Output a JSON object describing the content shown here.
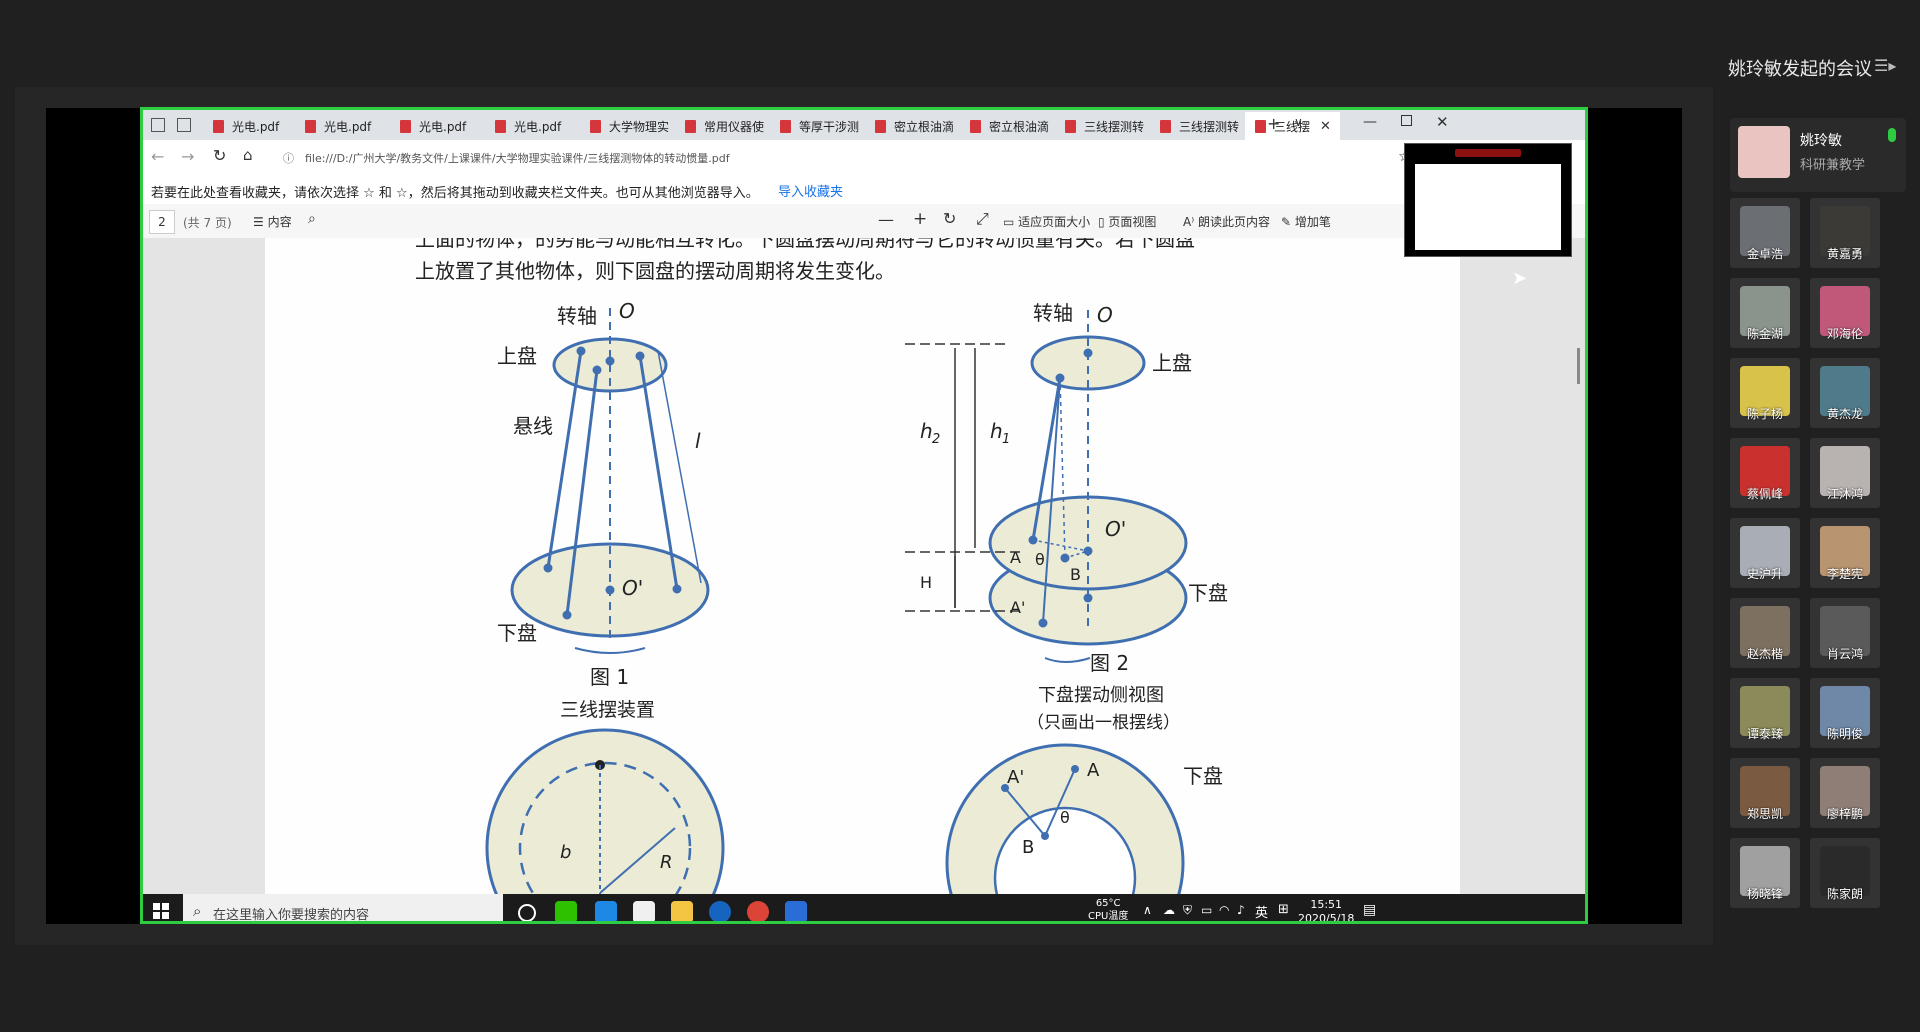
{
  "meeting": {
    "title": "姚玲敏发起的会议",
    "menu_icon": "list-icon"
  },
  "browser": {
    "tabs": [
      {
        "label": "光电.pdf"
      },
      {
        "label": "光电.pdf"
      },
      {
        "label": "光电.pdf"
      },
      {
        "label": "光电.pdf"
      },
      {
        "label": "大学物理实"
      },
      {
        "label": "常用仪器使"
      },
      {
        "label": "等厚干涉测"
      },
      {
        "label": "密立根油滴"
      },
      {
        "label": "密立根油滴"
      },
      {
        "label": "三线摆测转"
      },
      {
        "label": "三线摆测转"
      },
      {
        "label": "三线摆"
      }
    ],
    "address": "file:///D:/广州大学/教务文件/上课课件/大学物理实验课件/三线摆测物体的转动惯量.pdf",
    "favbar_text": "若要在此处查看收藏夹，请依次选择 ☆ 和 ☆，然后将其拖动到收藏夹栏文件夹。也可从其他浏览器导入。",
    "favbar_link": "导入收藏夹"
  },
  "pdf_toolbar": {
    "page_number": "2",
    "page_total": "(共 7 页)",
    "contents_label": "内容",
    "fit_label": "适应页面大小",
    "page_view_label": "页面视图",
    "read_aloud_label": "朗读此页内容",
    "add_note_label": "增加笔"
  },
  "document": {
    "top_line": "上面的物体，的势能与动能相互转化。下圆盘摆动周期将与它的转动惯量有关。若下圆盘",
    "line2": "上放置了其他物体，则下圆盘的摆动周期将发生变化。",
    "fig1": {
      "axis_label": "转轴",
      "o_label": "O",
      "top_disk": "上盘",
      "wire": "悬线",
      "l_label": "l",
      "o_prime": "O'",
      "bottom_disk": "下盘",
      "caption": "图 1",
      "subtitle": "三线摆装置"
    },
    "fig2": {
      "axis_label": "转轴",
      "o_label": "O",
      "top_disk": "上盘",
      "h2": "h",
      "h2_sub": "2",
      "h1": "h",
      "h1_sub": "1",
      "o_prime": "O'",
      "a_label": "A",
      "theta": "θ",
      "b_label": "B",
      "a_prime": "A'",
      "H_label": "H",
      "bottom_disk": "下盘",
      "caption": "图 2",
      "subtitle": "下盘摆动侧视图",
      "note": "（只画出一根摆线）"
    },
    "fig3": {
      "b_label": "b",
      "r_label": "R"
    },
    "fig4": {
      "a_prime": "A'",
      "a_label": "A",
      "theta": "θ",
      "b_label": "B",
      "bottom_disk": "下盘"
    }
  },
  "taskbar": {
    "search_placeholder": "在这里输入你要搜索的内容",
    "temp": "65°C",
    "cpu_label": "CPU温度",
    "ime": "英",
    "time": "15:51",
    "date": "2020/5/18"
  },
  "participants": {
    "host": {
      "name": "姚玲敏",
      "role": "科研兼教学",
      "mic_color": "#2ecc40"
    },
    "list": [
      {
        "name": "金卓浩",
        "color": "#6b6f74"
      },
      {
        "name": "黄嘉勇",
        "color": "#3b3a36"
      },
      {
        "name": "陈金湖",
        "color": "#8a948c"
      },
      {
        "name": "邓海伦",
        "color": "#c0587a"
      },
      {
        "name": "陈子杨",
        "color": "#d8c24a"
      },
      {
        "name": "黄杰龙",
        "color": "#4f7a8a"
      },
      {
        "name": "蔡佩峰",
        "color": "#c9312f"
      },
      {
        "name": "江沐鸿",
        "color": "#b8b2b0"
      },
      {
        "name": "史沪升",
        "color": "#a9adb5"
      },
      {
        "name": "李楚宪",
        "color": "#b89470"
      },
      {
        "name": "赵杰楷",
        "color": "#7d7060"
      },
      {
        "name": "肖云鸿",
        "color": "#5a5a5a"
      },
      {
        "name": "谭泰臻",
        "color": "#8a8a5a"
      },
      {
        "name": "陈明俊",
        "color": "#6f88a8"
      },
      {
        "name": "郑思凯",
        "color": "#7a5a40"
      },
      {
        "name": "廖梓鹏",
        "color": "#8e7e76"
      },
      {
        "name": "杨晓锋",
        "color": "#a0a0a0"
      },
      {
        "name": "陈家朗",
        "color": "#2a2a2a"
      }
    ]
  }
}
